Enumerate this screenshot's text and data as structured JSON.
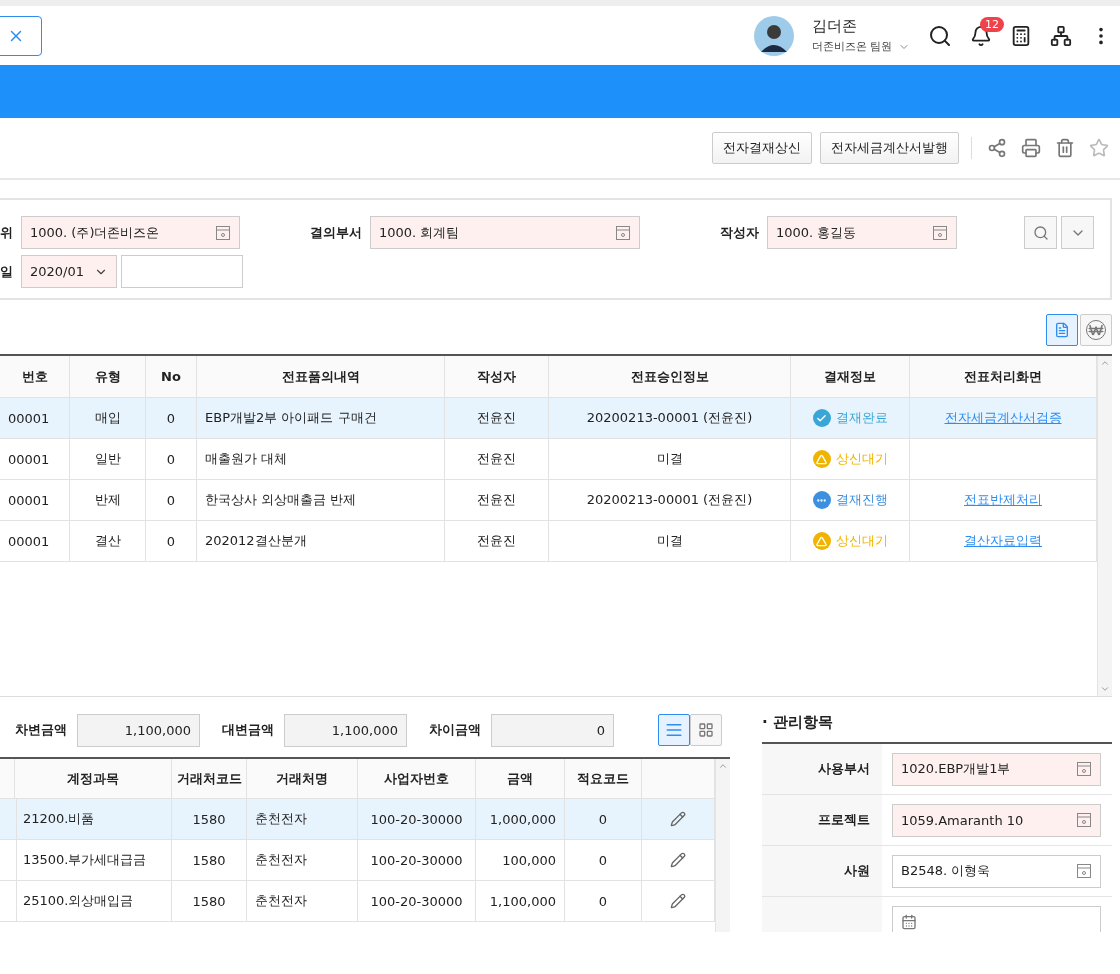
{
  "header": {
    "user": {
      "name": "김더존",
      "role": "더존비즈온 팀원"
    },
    "notification_count": "12"
  },
  "toolbar": {
    "buttons": [
      "전자결재상신",
      "전자세금계산서발행"
    ]
  },
  "search": {
    "rows": [
      [
        {
          "label": "위",
          "value": "1000. (주)더존비즈온",
          "kind": "code",
          "required": true
        },
        {
          "label": "결의부서",
          "value": "1000. 회계팀",
          "kind": "code",
          "required": true
        },
        {
          "label": "작성자",
          "value": "1000. 홍길동",
          "kind": "code",
          "required": true
        }
      ],
      [
        {
          "label": "일",
          "value": "2020/01",
          "kind": "select",
          "required": true
        },
        {
          "kind": "text",
          "required": false
        }
      ]
    ]
  },
  "view_toggle": [
    {
      "kind": "document",
      "selected": true
    },
    {
      "kind": "won",
      "selected": false
    }
  ],
  "table": {
    "columns": [
      "번호",
      "유형",
      "No",
      "전표품의내역",
      "작성자",
      "전표승인정보",
      "결재정보",
      "전표처리화면"
    ],
    "rows": [
      {
        "selected": true,
        "cells": [
          "00001",
          "매입",
          "0",
          "EBP개발2부 아이패드 구매건",
          "전윤진",
          "20200213-00001 (전윤진)"
        ],
        "status": {
          "kind": "done",
          "label": "결재완료"
        },
        "link": "전자세금계산서검증"
      },
      {
        "selected": false,
        "cells": [
          "00001",
          "일반",
          "0",
          "매출원가 대체",
          "전윤진",
          "미결"
        ],
        "status": {
          "kind": "waiting",
          "label": "상신대기"
        }
      },
      {
        "selected": false,
        "cells": [
          "00001",
          "반제",
          "0",
          "한국상사 외상매출금 반제",
          "전윤진",
          "20200213-00001 (전윤진)"
        ],
        "status": {
          "kind": "progress",
          "label": "결재진행"
        },
        "link": "전표반제처리"
      },
      {
        "selected": false,
        "cells": [
          "00001",
          "결산",
          "0",
          "202012결산분개",
          "전윤진",
          "미결"
        ],
        "status": {
          "kind": "waiting",
          "label": "상신대기"
        },
        "link": "결산자료입력"
      }
    ]
  },
  "totals": [
    {
      "label": "차변금액",
      "value": "1,100,000"
    },
    {
      "label": "대변금액",
      "value": "1,100,000"
    },
    {
      "label": "차이금액",
      "value": "0"
    }
  ],
  "layout_toggle": [
    {
      "kind": "list",
      "selected": true
    },
    {
      "kind": "grid",
      "selected": false
    }
  ],
  "entries": {
    "columns": [
      "계정과목",
      "거래처코드",
      "거래처명",
      "사업자번호",
      "금액",
      "적요코드"
    ],
    "rows": [
      {
        "selected": true,
        "cells": [
          "21200.비품",
          "1580",
          "춘천전자",
          "100-20-30000",
          "1,000,000",
          "0"
        ]
      },
      {
        "selected": false,
        "cells": [
          "13500.부가세대급금",
          "1580",
          "춘천전자",
          "100-20-30000",
          "100,000",
          "0"
        ]
      },
      {
        "selected": false,
        "cells": [
          "25100.외상매입금",
          "1580",
          "춘천전자",
          "100-20-30000",
          "1,100,000",
          "0"
        ]
      }
    ]
  },
  "management": {
    "title": "· 관리항목",
    "fields": [
      {
        "kind": "code",
        "label": "사용부서",
        "value": "1020.EBP개발1부",
        "required": true
      },
      {
        "kind": "code",
        "label": "프로젝트",
        "value": "1059.Amaranth 10",
        "required": true
      },
      {
        "kind": "code",
        "label": "사원",
        "value": "B2548. 이형욱",
        "required": false
      },
      {
        "kind": "date",
        "required": false
      }
    ]
  }
}
